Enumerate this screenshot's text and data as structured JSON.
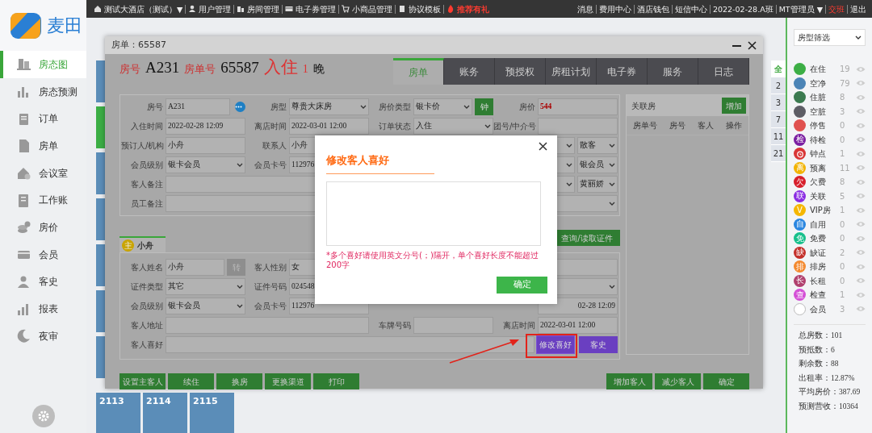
{
  "logo": {
    "text": "麦田"
  },
  "top_menu": [
    {
      "label": "测试大酒店（测试）▼",
      "kind": "normal"
    },
    {
      "label": "用户管理",
      "kind": "normal"
    },
    {
      "label": "房间管理",
      "kind": "normal"
    },
    {
      "label": "电子券管理",
      "kind": "normal"
    },
    {
      "label": "小商品管理",
      "kind": "normal"
    },
    {
      "label": "协议模板",
      "kind": "normal"
    },
    {
      "label": "推荐有礼",
      "kind": "promo"
    }
  ],
  "top_links": [
    {
      "label": "消息",
      "kind": "normal"
    },
    {
      "label": "费用中心",
      "kind": "normal"
    },
    {
      "label": "酒店钱包",
      "kind": "normal"
    },
    {
      "label": "短信中心",
      "kind": "normal"
    },
    {
      "label": "2022-02-28.A班",
      "kind": "normal"
    },
    {
      "label": "MT管理员 ▼",
      "kind": "normal"
    },
    {
      "label": "交班",
      "kind": "alert"
    },
    {
      "label": "退出",
      "kind": "normal"
    }
  ],
  "sidebar": {
    "items": [
      {
        "label": "房态图",
        "selected": true
      },
      {
        "label": "房态预测",
        "selected": false
      },
      {
        "label": "订单",
        "selected": false
      },
      {
        "label": "房单",
        "selected": false
      },
      {
        "label": "会议室",
        "selected": false
      },
      {
        "label": "工作账",
        "selected": false
      },
      {
        "label": "房价",
        "selected": false
      },
      {
        "label": "会员",
        "selected": false
      },
      {
        "label": "客史",
        "selected": false
      },
      {
        "label": "报表",
        "selected": false
      },
      {
        "label": "夜审",
        "selected": false
      }
    ]
  },
  "room_tiles": [
    {
      "number": "2113"
    },
    {
      "number": "2114"
    },
    {
      "number": "2115"
    }
  ],
  "floor_tabs": [
    {
      "label": "全",
      "selected": true
    },
    {
      "label": "2",
      "selected": false
    },
    {
      "label": "3",
      "selected": false
    },
    {
      "label": "7",
      "selected": false
    },
    {
      "label": "11",
      "selected": false
    },
    {
      "label": "21",
      "selected": false
    }
  ],
  "room_type_filter": {
    "value": "房型筛选"
  },
  "legend": [
    {
      "label": "在住",
      "count": "19",
      "kind": "dot",
      "color": "#3cae45"
    },
    {
      "label": "空净",
      "count": "79",
      "kind": "dot",
      "color": "#4b84b6"
    },
    {
      "label": "住脏",
      "count": "8",
      "kind": "dot",
      "color": "#3b7a4f"
    },
    {
      "label": "空脏",
      "count": "3",
      "kind": "dot",
      "color": "#5d5d65"
    },
    {
      "label": "停售",
      "count": "0",
      "kind": "dot",
      "color": "#e0514f"
    },
    {
      "label": "待检",
      "count": "0",
      "kind": "letter",
      "badge": "检",
      "color": "#7b1fa2"
    },
    {
      "label": "钟点",
      "count": "1",
      "kind": "alarm",
      "color": "#d93636"
    },
    {
      "label": "预离",
      "count": "11",
      "kind": "letter",
      "badge": "离",
      "color": "#f2b300"
    },
    {
      "label": "欠费",
      "count": "8",
      "kind": "letter",
      "badge": "欠",
      "color": "#d71f2b"
    },
    {
      "label": "关联",
      "count": "5",
      "kind": "letter",
      "badge": "联",
      "color": "#8a2be2"
    },
    {
      "label": "VIP房",
      "count": "1",
      "kind": "letter",
      "badge": "V",
      "color": "#f5b700"
    },
    {
      "label": "自用",
      "count": "0",
      "kind": "letter",
      "badge": "自",
      "color": "#2a86e0"
    },
    {
      "label": "免费",
      "count": "0",
      "kind": "letter",
      "badge": "免",
      "color": "#17c08b"
    },
    {
      "label": "缺证",
      "count": "2",
      "kind": "letter",
      "badge": "缺",
      "color": "#c4302b"
    },
    {
      "label": "排房",
      "count": "0",
      "kind": "letter",
      "badge": "排",
      "color": "#f3892f"
    },
    {
      "label": "长租",
      "count": "0",
      "kind": "letter",
      "badge": "长",
      "color": "#b0406e"
    },
    {
      "label": "检查",
      "count": "1",
      "kind": "letter",
      "badge": "查",
      "color": "#d44fd6"
    },
    {
      "label": "会员",
      "count": "3",
      "kind": "ring",
      "color": "#ffffff"
    }
  ],
  "stats": [
    "总房数：101",
    "预抵数：6",
    "剩余数：88",
    "出租率：12.87%",
    "平均房价：387.69",
    "预测营收：10364"
  ],
  "dialog": {
    "title": "房单：65587",
    "header": {
      "room_label": "房号",
      "room": "A231",
      "order_label": "房单号",
      "order": "65587",
      "status": "入住",
      "nights": "1",
      "nights_unit": "晚"
    },
    "tabs": [
      {
        "label": "房单",
        "selected": true
      },
      {
        "label": "账务",
        "selected": false
      },
      {
        "label": "预授权",
        "selected": false
      },
      {
        "label": "房租计划",
        "selected": false
      },
      {
        "label": "电子券",
        "selected": false
      },
      {
        "label": "服务",
        "selected": false
      },
      {
        "label": "日志",
        "selected": false
      }
    ],
    "form": [
      [
        {
          "label": "房号",
          "value": "A231",
          "kind": "more"
        },
        {
          "label": "房型",
          "value": "尊贵大床房",
          "kind": "select"
        },
        {
          "label": "房价类型",
          "value": "银卡价",
          "kind": "select-button",
          "button": {
            "label": "钟",
            "disabled": false
          }
        },
        {
          "label": "房价",
          "value": "544",
          "kind": "price"
        }
      ],
      [
        {
          "label": "入住时间",
          "value": "2022-02-28 12:09",
          "kind": "text"
        },
        {
          "label": "离店时间",
          "value": "2022-03-01 12:00",
          "kind": "text"
        },
        {
          "label": "订单状态",
          "value": "入住",
          "kind": "select"
        },
        {
          "label": "团号/中介号",
          "kind": "text"
        }
      ],
      [
        {
          "label": "预订人/机构",
          "value": "小舟",
          "kind": "text"
        },
        {
          "label": "联系人",
          "value": "小舟",
          "kind": "text"
        },
        {
          "value": "散客",
          "kind": "pair-select"
        }
      ],
      [
        {
          "label": "会员级别",
          "value": "银卡会员",
          "kind": "select"
        },
        {
          "label": "会员卡号",
          "value": "112976",
          "kind": "text"
        },
        {
          "value": "银会员",
          "kind": "pair-select"
        }
      ],
      [
        {
          "label": "客人备注",
          "kind": "wide"
        },
        {
          "value": "黄丽娇",
          "kind": "pair-select"
        }
      ],
      [
        {
          "label": "员工备注",
          "kind": "wide-select"
        }
      ]
    ],
    "guest_tab": {
      "badge": "主",
      "name": "小舟"
    },
    "id_button": "查询/读取证件",
    "guest_form": [
      [
        {
          "label": "客人姓名",
          "value": "小舟",
          "kind": "text-button",
          "button": {
            "label": "转",
            "disabled": true
          }
        },
        {
          "label": "客人性别",
          "value": "女",
          "kind": "text"
        },
        {
          "kind": "end-field"
        }
      ],
      [
        {
          "label": "证件类型",
          "value": "其它",
          "kind": "select"
        },
        {
          "label": "证件号码",
          "value": "024548",
          "kind": "text"
        },
        {
          "kind": "end-select"
        }
      ],
      [
        {
          "label": "会员级别",
          "value": "银卡会员",
          "kind": "select"
        },
        {
          "label": "会员卡号",
          "value": "112976",
          "kind": "text"
        },
        {
          "value": "02-28 12:09",
          "kind": "end-field"
        }
      ],
      [
        {
          "label": "客人地址",
          "kind": "address"
        },
        {
          "label": "车牌号码",
          "kind": "text"
        },
        {
          "label": "离店时间",
          "value": "2022-03-01 12:00",
          "kind": "text"
        }
      ],
      [
        {
          "label": "客人喜好",
          "kind": "pref",
          "buttons": [
            {
              "label": "修改喜好",
              "highlighted": true
            },
            {
              "label": "客史",
              "highlighted": false
            }
          ]
        }
      ]
    ],
    "related": {
      "title": "关联房",
      "add_button": "增加",
      "columns": [
        "房单号",
        "房号",
        "客人",
        "操作"
      ]
    },
    "actions_left": [
      "设置主客人",
      "续住",
      "换房",
      "更换渠道",
      "打印"
    ],
    "actions_right": [
      "增加客人",
      "减少客人",
      "确定"
    ]
  },
  "modal": {
    "title": "修改客人喜好",
    "hint": "*多个喜好请使用英文分号(；)隔开，单个喜好长度不能超过200字",
    "confirm": "确定"
  }
}
